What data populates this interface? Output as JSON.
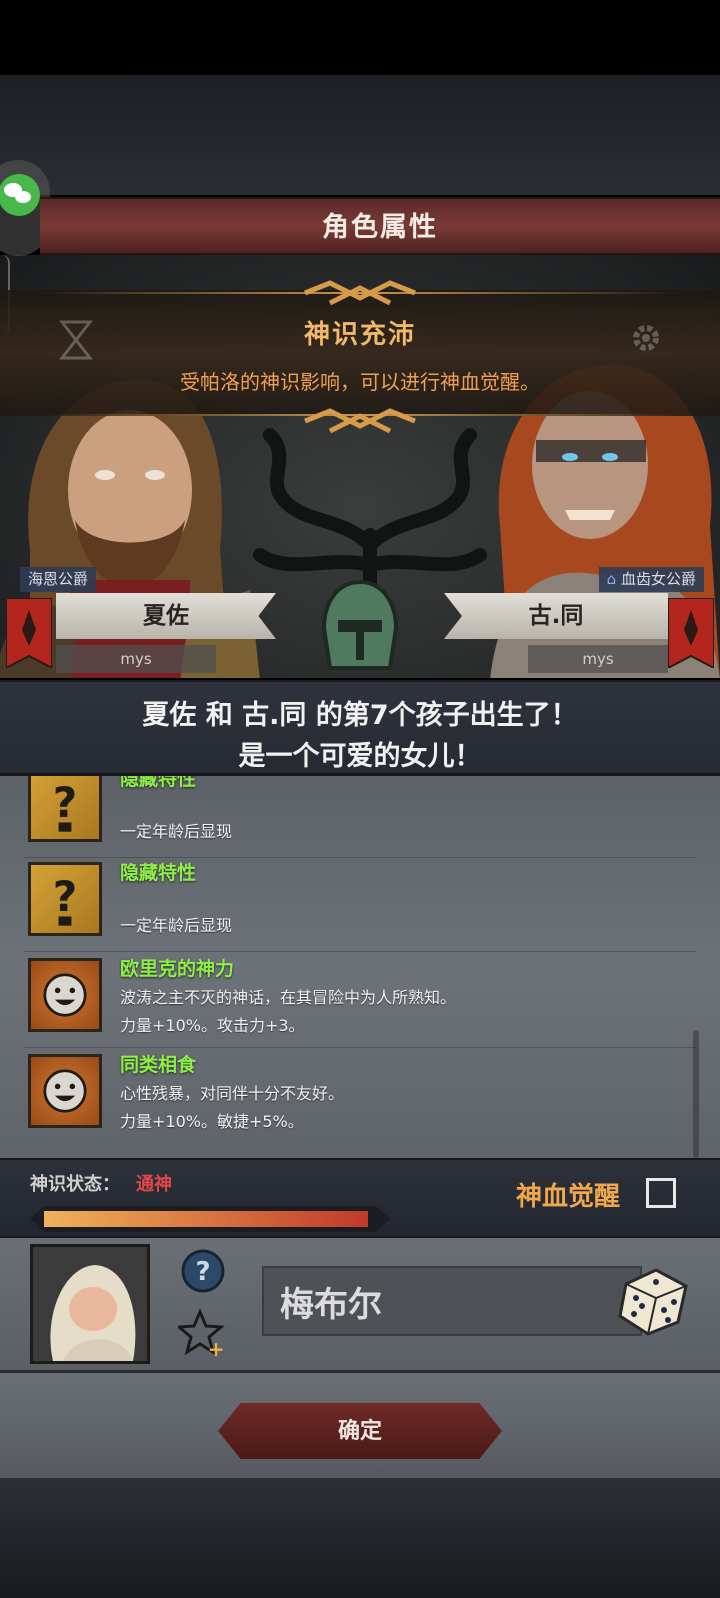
{
  "header": {
    "title": "角色属性"
  },
  "banner": {
    "title": "神识充沛",
    "subtitle": "受帕洛的神识影响，可以进行神血觉醒。"
  },
  "father": {
    "title": "海恩公爵",
    "name": "夏佐",
    "house": "mys"
  },
  "mother": {
    "title": "血齿女公爵",
    "name": "古.同",
    "house": "mys"
  },
  "announcement": {
    "line1": "夏佐 和 古.同 的第7个孩子出生了！",
    "line2": "是一个可爱的女儿！"
  },
  "traits": [
    {
      "name": "隐藏特性",
      "desc": [
        "一定年龄后显现"
      ],
      "icon": "question-mark-icon"
    },
    {
      "name": "隐藏特性",
      "desc": [
        "一定年龄后显现"
      ],
      "icon": "question-mark-icon"
    },
    {
      "name": "欧里克的神力",
      "desc": [
        "波涛之主不灭的神话，在其冒险中为人所熟知。",
        "力量+10%。攻击力+3。"
      ],
      "icon": "smiley-sun-icon"
    },
    {
      "name": "同类相食",
      "desc": [
        "心性残暴，对同伴十分不友好。",
        "力量+10%。敏捷+5%。"
      ],
      "icon": "smiley-sun-icon"
    }
  ],
  "status": {
    "label": "神识状态：",
    "value": "通神",
    "progress": 1.0,
    "awaken_label": "神血觉醒",
    "awaken_checked": false
  },
  "child": {
    "name_value": "梅布尔"
  },
  "footer": {
    "confirm_label": "确定"
  },
  "colors": {
    "accent_gold": "#f1b969",
    "trait_green": "#8ef046",
    "status_red": "#e04848",
    "button_red": "#6e2a26"
  }
}
